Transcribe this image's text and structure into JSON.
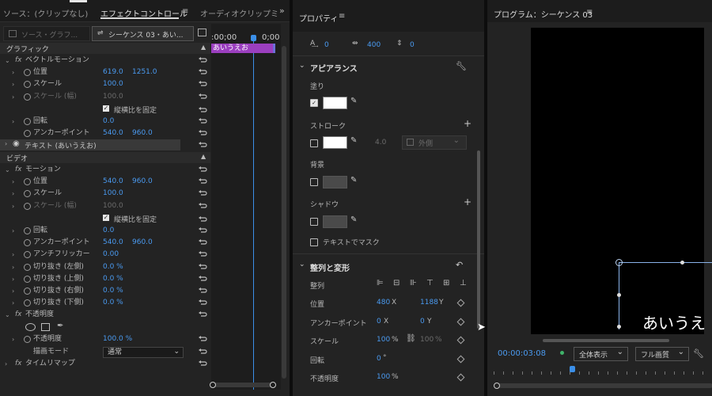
{
  "effect_controls": {
    "tab_source": "ソース：(クリップなし)",
    "tab_effect": "エフェクトコントロール",
    "tab_audio": "オーディオクリップミキ",
    "master_dropdown": "ソース・グラフ...",
    "sequence_dropdown": "シーケンス 03・あい...",
    "timecode_left": ":00;00",
    "timecode_right": "0;00",
    "clip_label": "あいうえお",
    "graphics_header": "グラフィック",
    "vector_motion": "ベクトルモーション",
    "video_header": "ビデオ",
    "motion": "モーション",
    "opacity_section": "不透明度",
    "time_remap": "タイムリマップ",
    "text_layer": "テキスト (あいうえお)",
    "uniform_scale": "縦横比を固定",
    "blend_mode_label": "描画モード",
    "blend_mode_value": "通常",
    "vector_rows": [
      {
        "label": "位置",
        "v1": "619.0",
        "v2": "1251.0",
        "chev": true,
        "dim": false
      },
      {
        "label": "スケール",
        "v1": "100.0",
        "v2": "",
        "chev": true,
        "dim": false
      },
      {
        "label": "スケール (幅)",
        "v1": "100.0",
        "v2": "",
        "chev": true,
        "dim": true
      },
      {
        "label": "回転",
        "v1": "0.0",
        "v2": "",
        "chev": true,
        "dim": false
      },
      {
        "label": "アンカーポイント",
        "v1": "540.0",
        "v2": "960.0",
        "chev": false,
        "dim": false
      }
    ],
    "motion_rows": [
      {
        "label": "位置",
        "v1": "540.0",
        "v2": "960.0",
        "chev": true,
        "dim": false
      },
      {
        "label": "スケール",
        "v1": "100.0",
        "v2": "",
        "chev": true,
        "dim": false
      },
      {
        "label": "スケール (幅)",
        "v1": "100.0",
        "v2": "",
        "chev": true,
        "dim": true
      },
      {
        "label": "回転",
        "v1": "0.0",
        "v2": "",
        "chev": true,
        "dim": false
      },
      {
        "label": "アンカーポイント",
        "v1": "540.0",
        "v2": "960.0",
        "chev": false,
        "dim": false
      },
      {
        "label": "アンチフリッカー",
        "v1": "0.00",
        "v2": "",
        "chev": true,
        "dim": false
      },
      {
        "label": "切り抜き (左側)",
        "v1": "0.0 %",
        "v2": "",
        "chev": true,
        "dim": false
      },
      {
        "label": "切り抜き (上側)",
        "v1": "0.0 %",
        "v2": "",
        "chev": true,
        "dim": false
      },
      {
        "label": "切り抜き (右側)",
        "v1": "0.0 %",
        "v2": "",
        "chev": true,
        "dim": false
      },
      {
        "label": "切り抜き (下側)",
        "v1": "0.0 %",
        "v2": "",
        "chev": true,
        "dim": false
      }
    ],
    "opacity_row": {
      "label": "不透明度",
      "v1": "100.0 %"
    }
  },
  "properties": {
    "title": "プロパティ",
    "top_values": [
      "0",
      "400",
      "0"
    ],
    "appearance": "アピアランス",
    "fill": "塗り",
    "stroke": "ストローク",
    "stroke_width": "4.0",
    "stroke_type": "外側",
    "background": "背景",
    "shadow": "シャドウ",
    "mask_with_text": "テキストでマスク",
    "align_transform": "整列と変形",
    "align": "整列",
    "position_label": "位置",
    "position_x": "480",
    "position_y": "1188",
    "anchor_label": "アンカーポイント",
    "anchor_x": "0",
    "anchor_y": "0",
    "scale_label": "スケール",
    "scale_value": "100",
    "scale_value2": "100",
    "rotation_label": "回転",
    "rotation_value": "0",
    "opacity_label": "不透明度",
    "opacity_value": "100",
    "unit_x": "X",
    "unit_y": "Y",
    "unit_pct": "%",
    "unit_deg": "°"
  },
  "program": {
    "title": "プログラム：シーケンス 03",
    "timecode": "00:00:03:08",
    "fit_dropdown": "全体表示",
    "quality_dropdown": "フル画質",
    "overlay_text": "あいうえ"
  },
  "colors": {
    "accent_blue": "#4a9af0",
    "clip_purple": "#9b3fbf",
    "panel_bg": "#232323"
  }
}
